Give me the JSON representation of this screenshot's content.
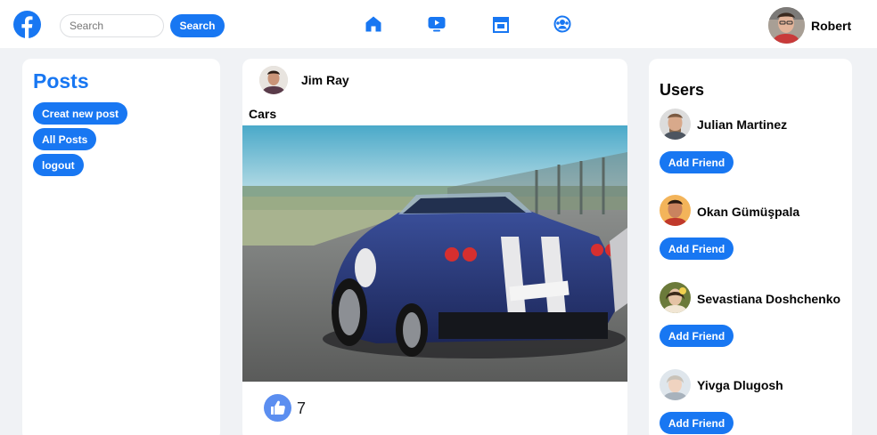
{
  "header": {
    "search_placeholder": "Search",
    "search_button": "Search",
    "nav_icons": [
      "home-icon",
      "video-icon",
      "store-icon",
      "groups-icon"
    ],
    "profile_name": "Robert"
  },
  "sidebar": {
    "title": "Posts",
    "buttons": [
      "Creat new post",
      "All Posts",
      "logout"
    ]
  },
  "post": {
    "author": "Jim Ray",
    "caption": "Cars",
    "likes": "7"
  },
  "users": {
    "title": "Users",
    "list": [
      {
        "name": "Julian Martinez",
        "button": "Add Friend"
      },
      {
        "name": "Okan Gümüşpala",
        "button": "Add Friend"
      },
      {
        "name": "Sevastiana Doshchenko",
        "button": "Add Friend"
      },
      {
        "name": "Yivga Dlugosh",
        "button": "Add Friend"
      }
    ]
  },
  "colors": {
    "accent": "#1877f2",
    "background": "#f0f2f5",
    "like": "#5b8ef0"
  }
}
